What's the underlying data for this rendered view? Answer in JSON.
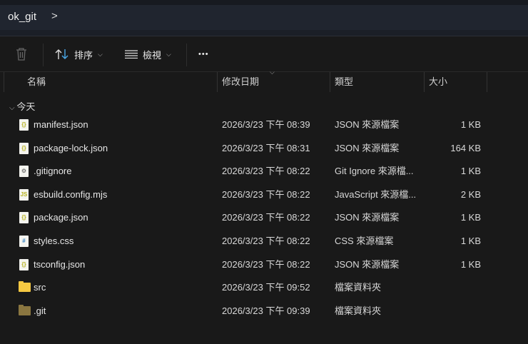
{
  "address": {
    "folder": "ok_git",
    "chevron": ">"
  },
  "toolbar": {
    "sort_label": "排序",
    "view_label": "檢視",
    "more_label": "•••"
  },
  "columns": {
    "name": "名稱",
    "date": "修改日期",
    "type": "類型",
    "size": "大小"
  },
  "group": {
    "label": "今天"
  },
  "files": [
    {
      "name": "manifest.json",
      "date": "2026/3/23 下午 08:39",
      "type": "JSON 來源檔案",
      "size": "1 KB",
      "icon": "json-file-icon"
    },
    {
      "name": "package-lock.json",
      "date": "2026/3/23 下午 08:31",
      "type": "JSON 來源檔案",
      "size": "164 KB",
      "icon": "json-file-icon"
    },
    {
      "name": ".gitignore",
      "date": "2026/3/23 下午 08:22",
      "type": "Git Ignore 來源檔...",
      "size": "1 KB",
      "icon": "gear-file-icon"
    },
    {
      "name": "esbuild.config.mjs",
      "date": "2026/3/23 下午 08:22",
      "type": "JavaScript 來源檔...",
      "size": "2 KB",
      "icon": "js-file-icon"
    },
    {
      "name": "package.json",
      "date": "2026/3/23 下午 08:22",
      "type": "JSON 來源檔案",
      "size": "1 KB",
      "icon": "json-file-icon"
    },
    {
      "name": "styles.css",
      "date": "2026/3/23 下午 08:22",
      "type": "CSS 來源檔案",
      "size": "1 KB",
      "icon": "css-file-icon"
    },
    {
      "name": "tsconfig.json",
      "date": "2026/3/23 下午 08:22",
      "type": "JSON 來源檔案",
      "size": "1 KB",
      "icon": "json-file-icon"
    },
    {
      "name": "src",
      "date": "2026/3/23 下午 09:52",
      "type": "檔案資料夾",
      "size": "",
      "icon": "folder-icon"
    },
    {
      "name": ".git",
      "date": "2026/3/23 下午 09:39",
      "type": "檔案資料夾",
      "size": "",
      "icon": "hidden-folder-icon"
    }
  ],
  "colors": {
    "folder": "#f5c842",
    "hidden_folder": "#8a7640",
    "accent": "#4aa8e8"
  }
}
